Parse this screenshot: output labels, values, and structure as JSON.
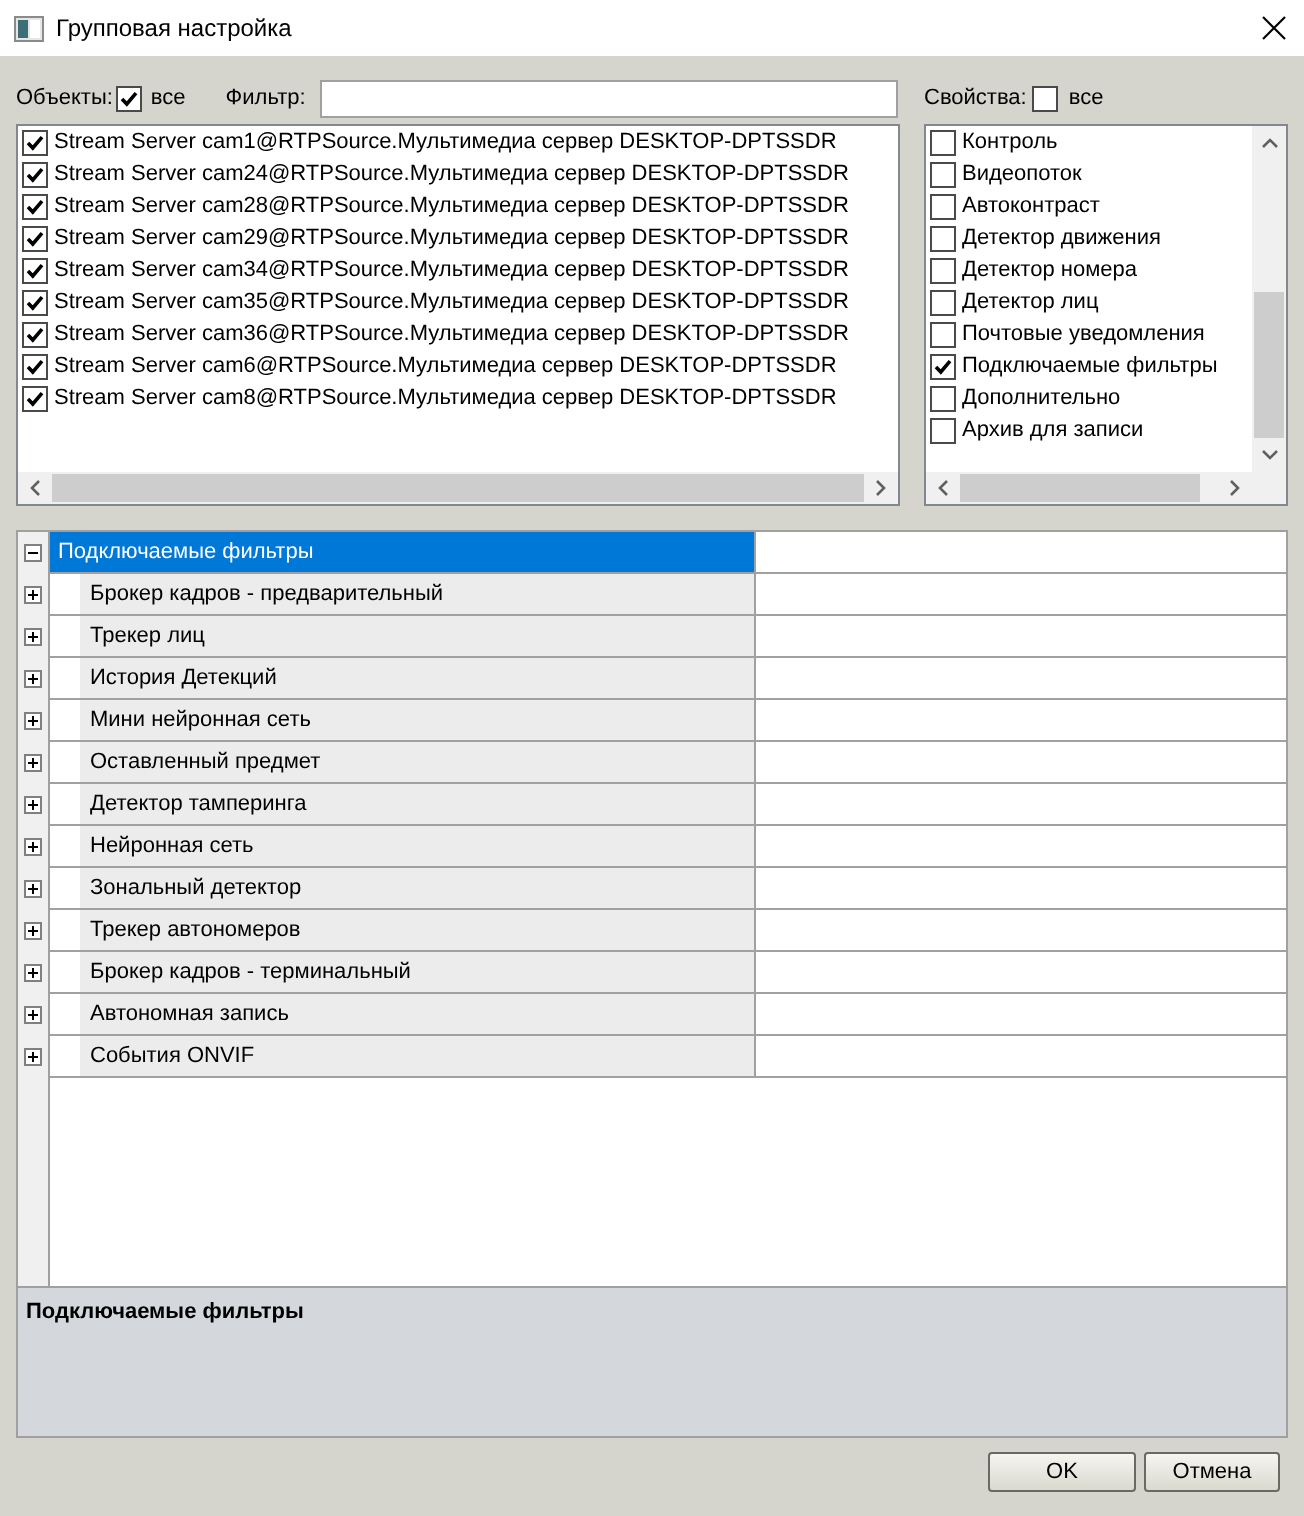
{
  "window": {
    "title": "Групповая настройка"
  },
  "objects": {
    "label": "Объекты:",
    "select_all": {
      "label": "все",
      "checked": true
    },
    "filter": {
      "label": "Фильтр:"
    },
    "items": [
      {
        "label": "Stream Server cam1@RTPSource.Мультимедиа сервер DESKTOP-DPTSSDR",
        "checked": true
      },
      {
        "label": "Stream Server cam24@RTPSource.Мультимедиа сервер DESKTOP-DPTSSDR",
        "checked": true
      },
      {
        "label": "Stream Server cam28@RTPSource.Мультимедиа сервер DESKTOP-DPTSSDR",
        "checked": true
      },
      {
        "label": "Stream Server cam29@RTPSource.Мультимедиа сервер DESKTOP-DPTSSDR",
        "checked": true
      },
      {
        "label": "Stream Server cam34@RTPSource.Мультимедиа сервер DESKTOP-DPTSSDR",
        "checked": true
      },
      {
        "label": "Stream Server cam35@RTPSource.Мультимедиа сервер DESKTOP-DPTSSDR",
        "checked": true
      },
      {
        "label": "Stream Server cam36@RTPSource.Мультимедиа сервер DESKTOP-DPTSSDR",
        "checked": true
      },
      {
        "label": "Stream Server cam6@RTPSource.Мультимедиа сервер DESKTOP-DPTSSDR",
        "checked": true
      },
      {
        "label": "Stream Server cam8@RTPSource.Мультимедиа сервер DESKTOP-DPTSSDR",
        "checked": true
      }
    ]
  },
  "properties": {
    "label": "Свойства:",
    "select_all": {
      "label": "все",
      "checked": false
    },
    "items": [
      {
        "label": "Контроль",
        "checked": false
      },
      {
        "label": "Видеопоток",
        "checked": false
      },
      {
        "label": "Автоконтраст",
        "checked": false
      },
      {
        "label": "Детектор движения",
        "checked": false
      },
      {
        "label": "Детектор номера",
        "checked": false
      },
      {
        "label": "Детектор лиц",
        "checked": false
      },
      {
        "label": "Почтовые уведомления",
        "checked": false
      },
      {
        "label": "Подключаемые фильтры",
        "checked": true
      },
      {
        "label": "Дополнительно",
        "checked": false
      },
      {
        "label": "Архив для записи",
        "checked": false
      }
    ]
  },
  "property_grid": {
    "categories": [
      {
        "label": "Подключаемые фильтры",
        "expanded": true,
        "selected": true,
        "children": [
          {
            "label": "Брокер кадров - предварительный",
            "expanded": false,
            "selected": false
          },
          {
            "label": "Трекер лиц",
            "expanded": false,
            "selected": false
          },
          {
            "label": "История Детекций",
            "expanded": false,
            "selected": false
          },
          {
            "label": "Мини нейронная сеть",
            "expanded": false,
            "selected": false
          },
          {
            "label": "Оставленный предмет",
            "expanded": false,
            "selected": false
          },
          {
            "label": "Детектор тамперинга",
            "expanded": false,
            "selected": false
          },
          {
            "label": "Нейронная сеть",
            "expanded": false,
            "selected": false
          },
          {
            "label": "Зональный детектор",
            "expanded": false,
            "selected": false
          },
          {
            "label": "Трекер автономеров",
            "expanded": false,
            "selected": false
          },
          {
            "label": "Брокер кадров - терминальный",
            "expanded": false,
            "selected": false
          },
          {
            "label": "Автономная запись",
            "expanded": false,
            "selected": false
          },
          {
            "label": "События ONVIF",
            "expanded": false,
            "selected": false
          }
        ]
      }
    ]
  },
  "description": {
    "title": "Подключаемые фильтры"
  },
  "buttons": [
    {
      "label": "OK"
    },
    {
      "label": "Отмена"
    }
  ]
}
